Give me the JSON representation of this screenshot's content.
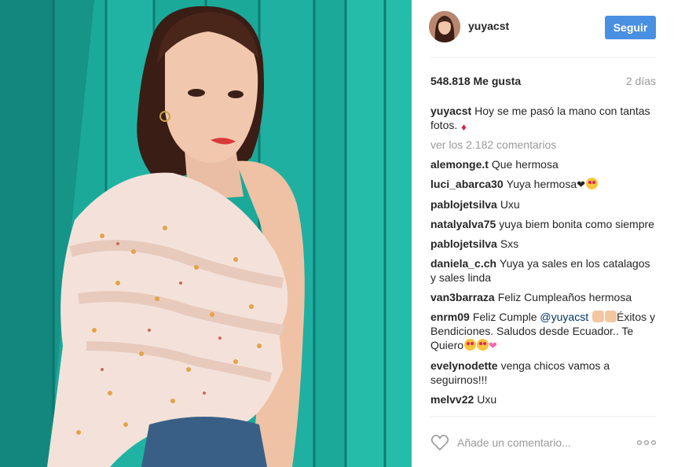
{
  "post": {
    "username": "yuyacst",
    "follow_label": "Seguir",
    "likes": "548.818 Me gusta",
    "time": "2 días",
    "caption_user": "yuyacst",
    "caption_text": "Hoy se me pasó la mano con tantas fotos.",
    "view_all": "ver los 2.182 comentarios"
  },
  "comments": [
    {
      "user": "alemonge.t",
      "text": "Que hermosa"
    },
    {
      "user": "luci_abarca30",
      "text": "Yuya hermosa"
    },
    {
      "user": "pablojetsilva",
      "text": "Uxu"
    },
    {
      "user": "natalyalva75",
      "text": "yuya biem bonita como siempre"
    },
    {
      "user": "pablojetsilva",
      "text": "Sxs"
    },
    {
      "user": "daniela_c.ch",
      "text": "Yuya ya sales en los catalagos y sales linda"
    },
    {
      "user": "van3barraza",
      "text": "Feliz Cumpleaños hermosa"
    },
    {
      "user": "enrm09",
      "text_before": "Feliz Cumple",
      "mention": "@yuyacst",
      "text_after": "Éxitos y Bendiciones. Saludos desde Ecuador.. Te Quiero"
    },
    {
      "user": "evelynodette",
      "text": "venga chicos vamos a seguirnos!!!"
    },
    {
      "user": "melvv22",
      "text": "Uxu"
    }
  ],
  "composer": {
    "placeholder": "Añade un comentario..."
  },
  "icons": {
    "like": "heart-outline-icon",
    "options": "more-options-icon"
  },
  "colors": {
    "accent": "#4a90e2",
    "wall": "#1aa898",
    "muted": "#999999"
  }
}
